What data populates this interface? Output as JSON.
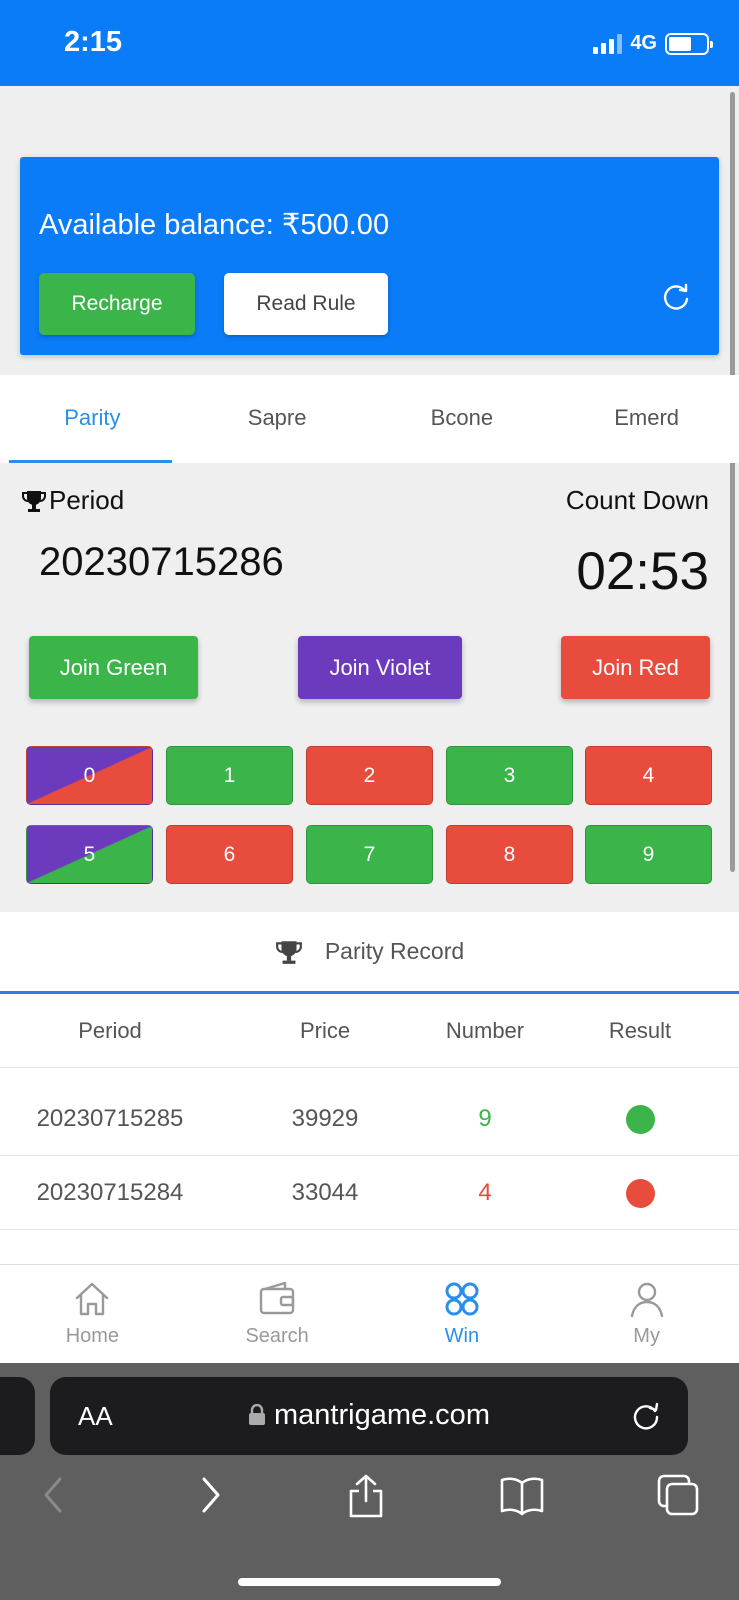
{
  "status_bar": {
    "time": "2:15",
    "network": "4G"
  },
  "balance": {
    "text": "Available balance: ₹500.00",
    "recharge_label": "Recharge",
    "read_rule_label": "Read Rule"
  },
  "tabs": [
    {
      "label": "Parity",
      "active": true
    },
    {
      "label": "Sapre"
    },
    {
      "label": "Bcone"
    },
    {
      "label": "Emerd"
    }
  ],
  "game": {
    "period_label": "Period",
    "period_value": "20230715286",
    "countdown_label": "Count Down",
    "countdown_value": "02:53",
    "join_green": "Join Green",
    "join_violet": "Join Violet",
    "join_red": "Join Red",
    "numbers": [
      {
        "label": "0",
        "color": "violet-red"
      },
      {
        "label": "1",
        "color": "green"
      },
      {
        "label": "2",
        "color": "red"
      },
      {
        "label": "3",
        "color": "green"
      },
      {
        "label": "4",
        "color": "red"
      },
      {
        "label": "5",
        "color": "violet-green"
      },
      {
        "label": "6",
        "color": "red"
      },
      {
        "label": "7",
        "color": "green"
      },
      {
        "label": "8",
        "color": "red"
      },
      {
        "label": "9",
        "color": "green"
      }
    ]
  },
  "record": {
    "title": "Parity Record",
    "headers": [
      "Period",
      "Price",
      "Number",
      "Result"
    ],
    "rows": [
      {
        "period": "20230715285",
        "price": "39929",
        "number": "9",
        "result": "green"
      },
      {
        "period": "20230715284",
        "price": "33044",
        "number": "4",
        "result": "red"
      }
    ]
  },
  "nav": [
    {
      "label": "Home",
      "icon": "home-icon"
    },
    {
      "label": "Search",
      "icon": "wallet-icon"
    },
    {
      "label": "Win",
      "icon": "clover-icon",
      "active": true
    },
    {
      "label": "My",
      "icon": "user-icon"
    }
  ],
  "browser": {
    "aa": "AA",
    "url": "mantrigame.com"
  },
  "colors": {
    "primary": "#0a7cf7",
    "green": "#3bb54a",
    "red": "#e74c3c",
    "violet": "#6c3bbd",
    "accent": "#2a8fe8"
  }
}
